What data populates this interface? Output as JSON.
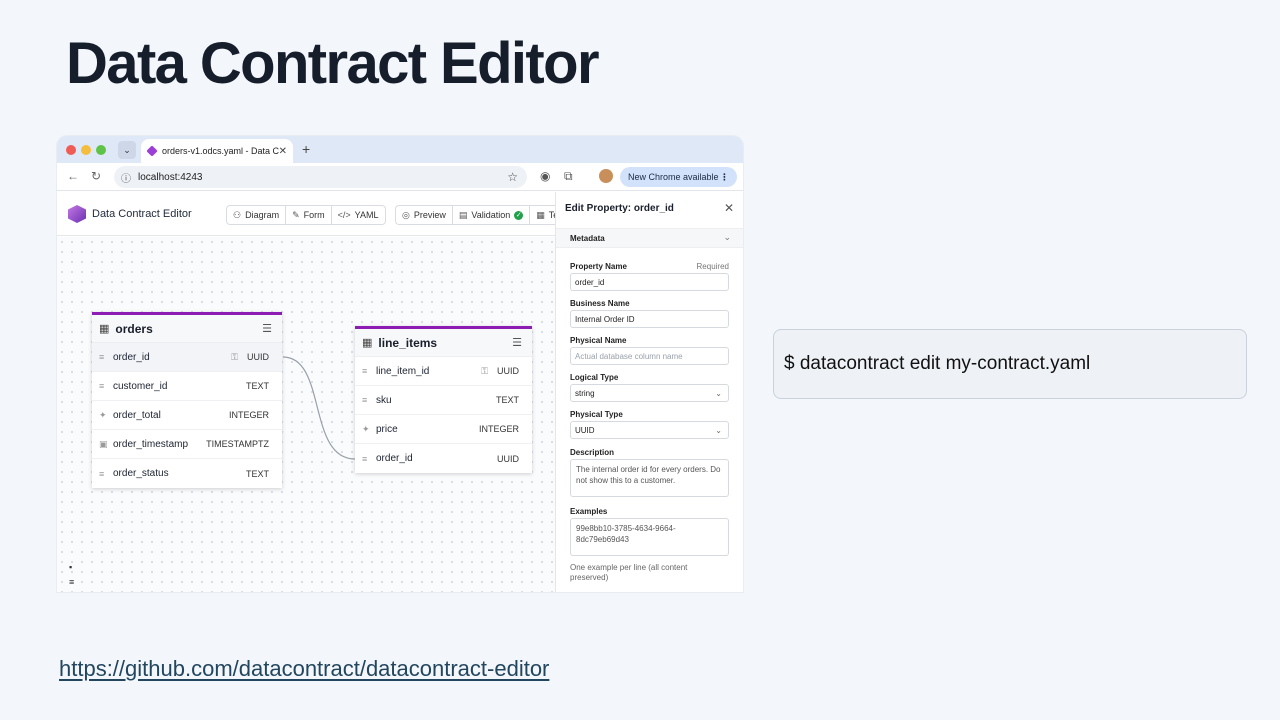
{
  "slide": {
    "title": "Data Contract Editor",
    "command": "$ datacontract edit my-contract.yaml",
    "link": "https://github.com/datacontract/datacontract-editor"
  },
  "browser": {
    "tab_title": "orders-v1.odcs.yaml - Data C",
    "url": "localhost:4243",
    "chrome_badge": "New Chrome available"
  },
  "app": {
    "name": "Data Contract Editor",
    "tools": {
      "diagram": "Diagram",
      "form": "Form",
      "yaml": "YAML",
      "preview": "Preview",
      "validation": "Validation",
      "test": "Te"
    }
  },
  "entities": {
    "orders": {
      "name": "orders",
      "rows": [
        {
          "name": "order_id",
          "type": "UUID"
        },
        {
          "name": "customer_id",
          "type": "TEXT"
        },
        {
          "name": "order_total",
          "type": "INTEGER"
        },
        {
          "name": "order_timestamp",
          "type": "TIMESTAMPTZ"
        },
        {
          "name": "order_status",
          "type": "TEXT"
        }
      ]
    },
    "line_items": {
      "name": "line_items",
      "rows": [
        {
          "name": "line_item_id",
          "type": "UUID"
        },
        {
          "name": "sku",
          "type": "TEXT"
        },
        {
          "name": "price",
          "type": "INTEGER"
        },
        {
          "name": "order_id",
          "type": "UUID"
        }
      ]
    }
  },
  "panel": {
    "title": "Edit Property: order_id",
    "section": "Metadata",
    "property_name_label": "Property Name",
    "required_label": "Required",
    "property_name_value": "order_id",
    "business_name_label": "Business Name",
    "business_name_value": "Internal Order ID",
    "physical_name_label": "Physical Name",
    "physical_name_placeholder": "Actual database column name",
    "logical_type_label": "Logical Type",
    "logical_type_value": "string",
    "physical_type_label": "Physical Type",
    "physical_type_value": "UUID",
    "description_label": "Description",
    "description_value": "The internal order id for every orders. Do not show this to a customer.",
    "examples_label": "Examples",
    "examples_value": "99e8bb10-3785-4634-9664-8dc79eb69d43",
    "examples_hint": "One example per line (all content preserved)"
  },
  "colors": {
    "entity_accent": "#8d1cb4",
    "validation_ok": "#22a04a",
    "chrome_badge_bg": "#d3e2fb"
  }
}
